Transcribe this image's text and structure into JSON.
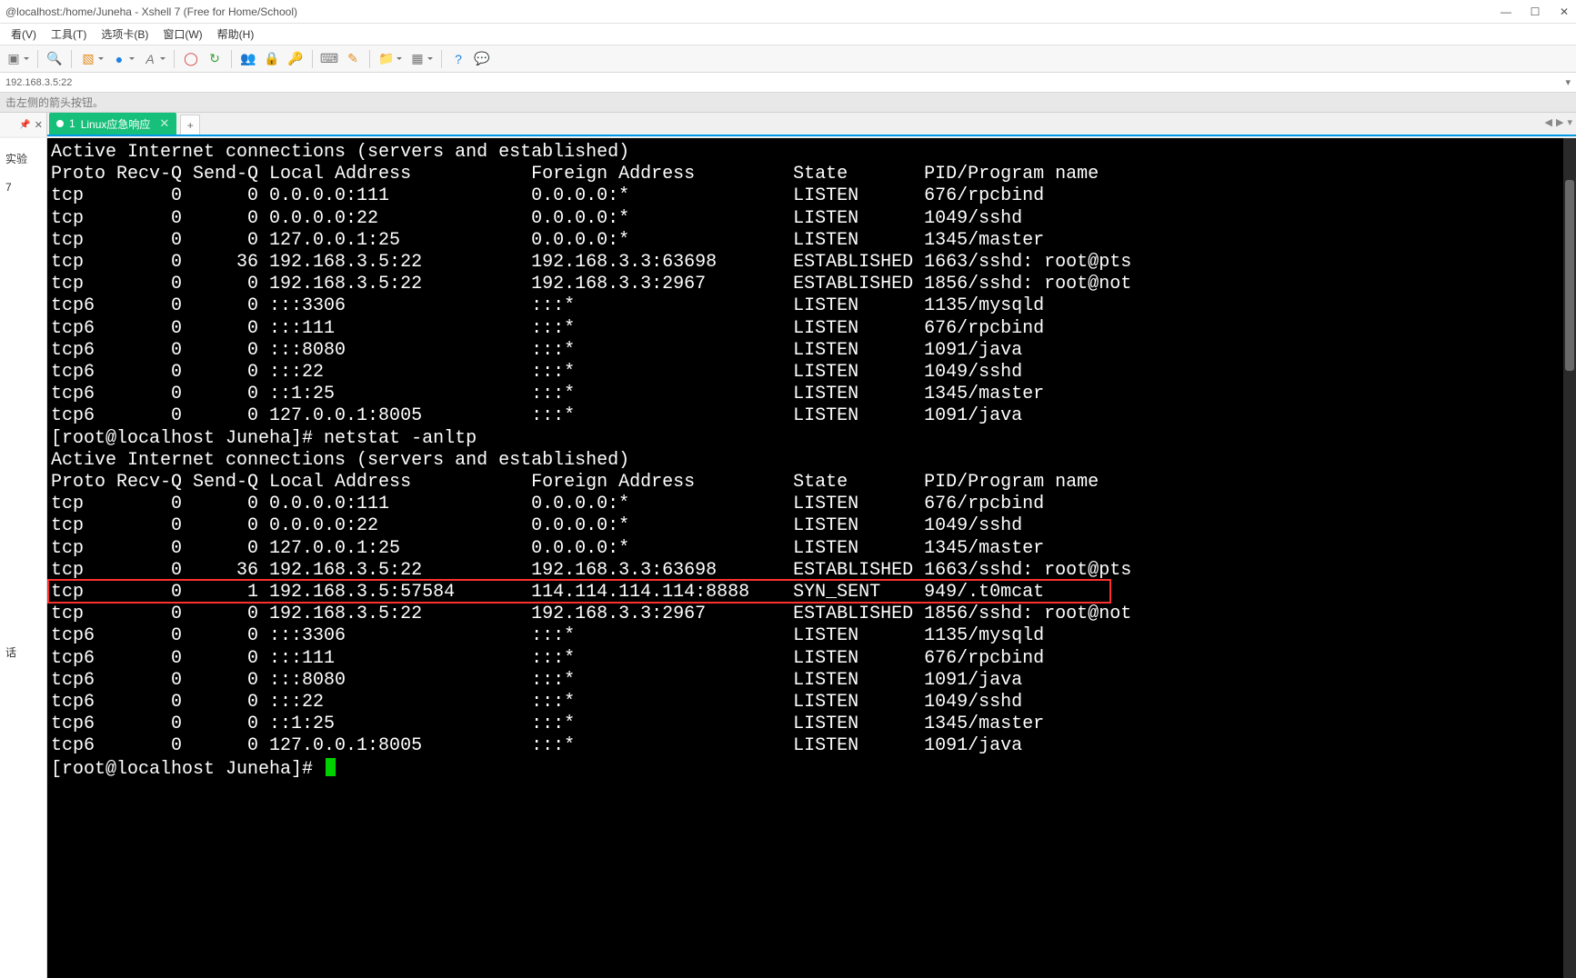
{
  "window": {
    "title": "@localhost:/home/Juneha - Xshell 7 (Free for Home/School)"
  },
  "menu": {
    "items": [
      "看(V)",
      "工具(T)",
      "选项卡(B)",
      "窗口(W)",
      "帮助(H)"
    ]
  },
  "addressbar": {
    "text": "192.168.3.5:22"
  },
  "infobar": {
    "text": "击左侧的箭头按钮。"
  },
  "tab": {
    "index": "1",
    "label": "Linux应急响应"
  },
  "nav": {
    "left": "◀",
    "right": "▶",
    "menu": "▾"
  },
  "sidebar": {
    "items": [
      "实验",
      "7",
      "话"
    ]
  },
  "terminal": {
    "header1": "Active Internet connections (servers and established)",
    "colhdr": "Proto Recv-Q Send-Q Local Address           Foreign Address         State       PID/Program name    ",
    "block1_rows": [
      "tcp        0      0 0.0.0.0:111             0.0.0.0:*               LISTEN      676/rpcbind         ",
      "tcp        0      0 0.0.0.0:22              0.0.0.0:*               LISTEN      1049/sshd           ",
      "tcp        0      0 127.0.0.1:25            0.0.0.0:*               LISTEN      1345/master         ",
      "tcp        0     36 192.168.3.5:22          192.168.3.3:63698       ESTABLISHED 1663/sshd: root@pts ",
      "tcp        0      0 192.168.3.5:22          192.168.3.3:2967        ESTABLISHED 1856/sshd: root@not ",
      "tcp6       0      0 :::3306                 :::*                    LISTEN      1135/mysqld         ",
      "tcp6       0      0 :::111                  :::*                    LISTEN      676/rpcbind         ",
      "tcp6       0      0 :::8080                 :::*                    LISTEN      1091/java           ",
      "tcp6       0      0 :::22                   :::*                    LISTEN      1049/sshd           ",
      "tcp6       0      0 ::1:25                  :::*                    LISTEN      1345/master         ",
      "tcp6       0      0 127.0.0.1:8005          :::*                    LISTEN      1091/java           "
    ],
    "prompt1": "[root@localhost Juneha]# netstat -anltp",
    "header2": "Active Internet connections (servers and established)",
    "block2_rows": [
      "tcp        0      0 0.0.0.0:111             0.0.0.0:*               LISTEN      676/rpcbind         ",
      "tcp        0      0 0.0.0.0:22              0.0.0.0:*               LISTEN      1049/sshd           ",
      "tcp        0      0 127.0.0.1:25            0.0.0.0:*               LISTEN      1345/master         ",
      "tcp        0     36 192.168.3.5:22          192.168.3.3:63698       ESTABLISHED 1663/sshd: root@pts ",
      "tcp        0      1 192.168.3.5:57584       114.114.114.114:8888    SYN_SENT    949/.t0mcat         ",
      "tcp        0      0 192.168.3.5:22          192.168.3.3:2967        ESTABLISHED 1856/sshd: root@not ",
      "tcp6       0      0 :::3306                 :::*                    LISTEN      1135/mysqld         ",
      "tcp6       0      0 :::111                  :::*                    LISTEN      676/rpcbind         ",
      "tcp6       0      0 :::8080                 :::*                    LISTEN      1091/java           ",
      "tcp6       0      0 :::22                   :::*                    LISTEN      1049/sshd           ",
      "tcp6       0      0 ::1:25                  :::*                    LISTEN      1345/master         ",
      "tcp6       0      0 127.0.0.1:8005          :::*                    LISTEN      1091/java           "
    ],
    "prompt2": "[root@localhost Juneha]# ",
    "highlight_row_index": 4
  },
  "icons": {
    "min": "—",
    "max": "☐",
    "close": "✕",
    "pin": "📌",
    "x": "✕",
    "plus": "+"
  }
}
